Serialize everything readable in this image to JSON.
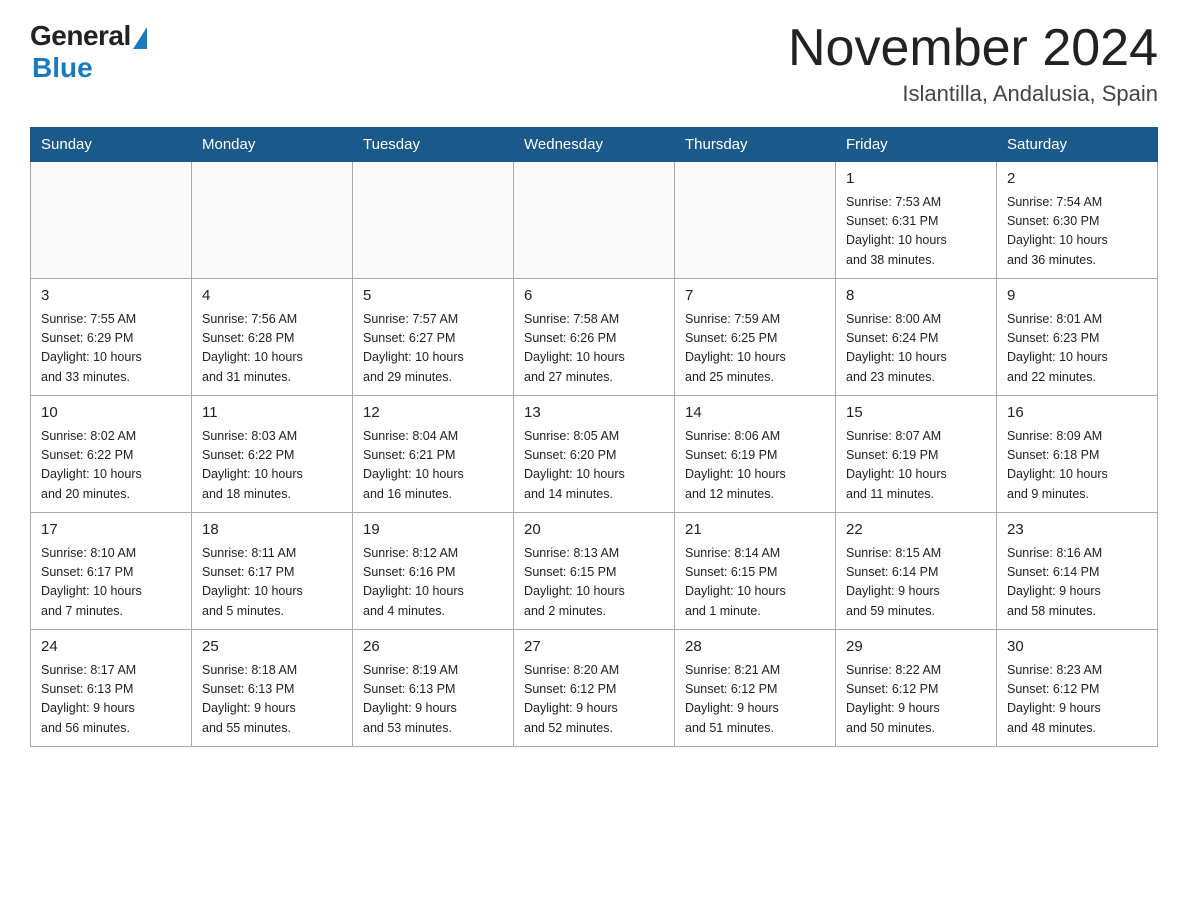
{
  "logo": {
    "general_text": "General",
    "blue_text": "Blue"
  },
  "header": {
    "month_year": "November 2024",
    "location": "Islantilla, Andalusia, Spain"
  },
  "weekdays": [
    "Sunday",
    "Monday",
    "Tuesday",
    "Wednesday",
    "Thursday",
    "Friday",
    "Saturday"
  ],
  "weeks": [
    [
      {
        "day": "",
        "info": ""
      },
      {
        "day": "",
        "info": ""
      },
      {
        "day": "",
        "info": ""
      },
      {
        "day": "",
        "info": ""
      },
      {
        "day": "",
        "info": ""
      },
      {
        "day": "1",
        "info": "Sunrise: 7:53 AM\nSunset: 6:31 PM\nDaylight: 10 hours\nand 38 minutes."
      },
      {
        "day": "2",
        "info": "Sunrise: 7:54 AM\nSunset: 6:30 PM\nDaylight: 10 hours\nand 36 minutes."
      }
    ],
    [
      {
        "day": "3",
        "info": "Sunrise: 7:55 AM\nSunset: 6:29 PM\nDaylight: 10 hours\nand 33 minutes."
      },
      {
        "day": "4",
        "info": "Sunrise: 7:56 AM\nSunset: 6:28 PM\nDaylight: 10 hours\nand 31 minutes."
      },
      {
        "day": "5",
        "info": "Sunrise: 7:57 AM\nSunset: 6:27 PM\nDaylight: 10 hours\nand 29 minutes."
      },
      {
        "day": "6",
        "info": "Sunrise: 7:58 AM\nSunset: 6:26 PM\nDaylight: 10 hours\nand 27 minutes."
      },
      {
        "day": "7",
        "info": "Sunrise: 7:59 AM\nSunset: 6:25 PM\nDaylight: 10 hours\nand 25 minutes."
      },
      {
        "day": "8",
        "info": "Sunrise: 8:00 AM\nSunset: 6:24 PM\nDaylight: 10 hours\nand 23 minutes."
      },
      {
        "day": "9",
        "info": "Sunrise: 8:01 AM\nSunset: 6:23 PM\nDaylight: 10 hours\nand 22 minutes."
      }
    ],
    [
      {
        "day": "10",
        "info": "Sunrise: 8:02 AM\nSunset: 6:22 PM\nDaylight: 10 hours\nand 20 minutes."
      },
      {
        "day": "11",
        "info": "Sunrise: 8:03 AM\nSunset: 6:22 PM\nDaylight: 10 hours\nand 18 minutes."
      },
      {
        "day": "12",
        "info": "Sunrise: 8:04 AM\nSunset: 6:21 PM\nDaylight: 10 hours\nand 16 minutes."
      },
      {
        "day": "13",
        "info": "Sunrise: 8:05 AM\nSunset: 6:20 PM\nDaylight: 10 hours\nand 14 minutes."
      },
      {
        "day": "14",
        "info": "Sunrise: 8:06 AM\nSunset: 6:19 PM\nDaylight: 10 hours\nand 12 minutes."
      },
      {
        "day": "15",
        "info": "Sunrise: 8:07 AM\nSunset: 6:19 PM\nDaylight: 10 hours\nand 11 minutes."
      },
      {
        "day": "16",
        "info": "Sunrise: 8:09 AM\nSunset: 6:18 PM\nDaylight: 10 hours\nand 9 minutes."
      }
    ],
    [
      {
        "day": "17",
        "info": "Sunrise: 8:10 AM\nSunset: 6:17 PM\nDaylight: 10 hours\nand 7 minutes."
      },
      {
        "day": "18",
        "info": "Sunrise: 8:11 AM\nSunset: 6:17 PM\nDaylight: 10 hours\nand 5 minutes."
      },
      {
        "day": "19",
        "info": "Sunrise: 8:12 AM\nSunset: 6:16 PM\nDaylight: 10 hours\nand 4 minutes."
      },
      {
        "day": "20",
        "info": "Sunrise: 8:13 AM\nSunset: 6:15 PM\nDaylight: 10 hours\nand 2 minutes."
      },
      {
        "day": "21",
        "info": "Sunrise: 8:14 AM\nSunset: 6:15 PM\nDaylight: 10 hours\nand 1 minute."
      },
      {
        "day": "22",
        "info": "Sunrise: 8:15 AM\nSunset: 6:14 PM\nDaylight: 9 hours\nand 59 minutes."
      },
      {
        "day": "23",
        "info": "Sunrise: 8:16 AM\nSunset: 6:14 PM\nDaylight: 9 hours\nand 58 minutes."
      }
    ],
    [
      {
        "day": "24",
        "info": "Sunrise: 8:17 AM\nSunset: 6:13 PM\nDaylight: 9 hours\nand 56 minutes."
      },
      {
        "day": "25",
        "info": "Sunrise: 8:18 AM\nSunset: 6:13 PM\nDaylight: 9 hours\nand 55 minutes."
      },
      {
        "day": "26",
        "info": "Sunrise: 8:19 AM\nSunset: 6:13 PM\nDaylight: 9 hours\nand 53 minutes."
      },
      {
        "day": "27",
        "info": "Sunrise: 8:20 AM\nSunset: 6:12 PM\nDaylight: 9 hours\nand 52 minutes."
      },
      {
        "day": "28",
        "info": "Sunrise: 8:21 AM\nSunset: 6:12 PM\nDaylight: 9 hours\nand 51 minutes."
      },
      {
        "day": "29",
        "info": "Sunrise: 8:22 AM\nSunset: 6:12 PM\nDaylight: 9 hours\nand 50 minutes."
      },
      {
        "day": "30",
        "info": "Sunrise: 8:23 AM\nSunset: 6:12 PM\nDaylight: 9 hours\nand 48 minutes."
      }
    ]
  ]
}
